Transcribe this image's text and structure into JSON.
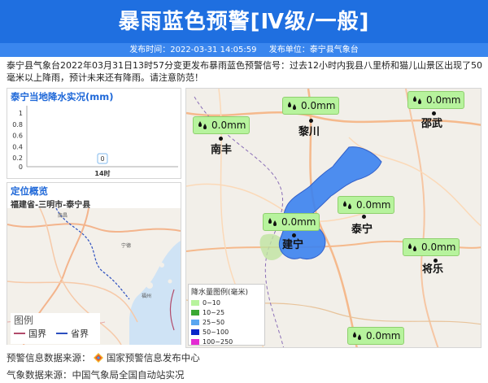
{
  "header": {
    "title": "暴雨蓝色预警[Ⅳ级/一般]",
    "time_label": "发布时间：2022-03-31 14:05:59",
    "unit_label": "发布单位：泰宁县气象台"
  },
  "description": "泰宁县气象台2022年03月31日13时57分变更发布暴雨蓝色预警信号：过去12小时内我县八里桥和猫儿山景区出现了50毫米以上降雨，预计未来还有降雨。请注意防范！",
  "rain_panel": {
    "title": "泰宁当地降水实况(mm)"
  },
  "chart_data": {
    "type": "bar",
    "categories": [
      "14时"
    ],
    "values": [
      0
    ],
    "ylim": [
      0,
      1
    ],
    "yticks": [
      "1",
      "0.8",
      "0.6",
      "0.4",
      "0.2",
      "0"
    ],
    "data_label": "0",
    "title": "泰宁当地降水实况(mm)",
    "xlabel": "",
    "ylabel": ""
  },
  "location_panel": {
    "title": "定位概览",
    "breadcrumb": "福建省-三明市-泰宁县",
    "legend_title": "图例",
    "legend_items": [
      {
        "label": "国界",
        "color": "#b24b6b"
      },
      {
        "label": "省界",
        "color": "#2c4fbf"
      }
    ]
  },
  "map": {
    "callouts": [
      {
        "text": "0.0mm"
      },
      {
        "text": "0.0mm"
      },
      {
        "text": "0.0mm"
      },
      {
        "text": "0.0mm"
      },
      {
        "text": "0.0mm"
      },
      {
        "text": "0.0mm"
      },
      {
        "text": "0.0mm"
      }
    ],
    "cities": [
      "黎川",
      "邵武",
      "南丰",
      "泰宁",
      "建宁",
      "将乐"
    ],
    "legend_title": "降水量图例(毫米)",
    "legend_items": [
      {
        "label": "0~10",
        "color": "#b7f39d"
      },
      {
        "label": "10~25",
        "color": "#3aa834"
      },
      {
        "label": "25~50",
        "color": "#5aa6f0"
      },
      {
        "label": "50~100",
        "color": "#0b27c8"
      },
      {
        "label": "100~250",
        "color": "#e42bd3"
      }
    ],
    "area_color": "#3b82f0"
  },
  "footer": {
    "source1": "预警信息数据来源：",
    "source1_name": "国家预警信息发布中心",
    "source2": "气象数据来源：中国气象局全国自动站实况"
  }
}
